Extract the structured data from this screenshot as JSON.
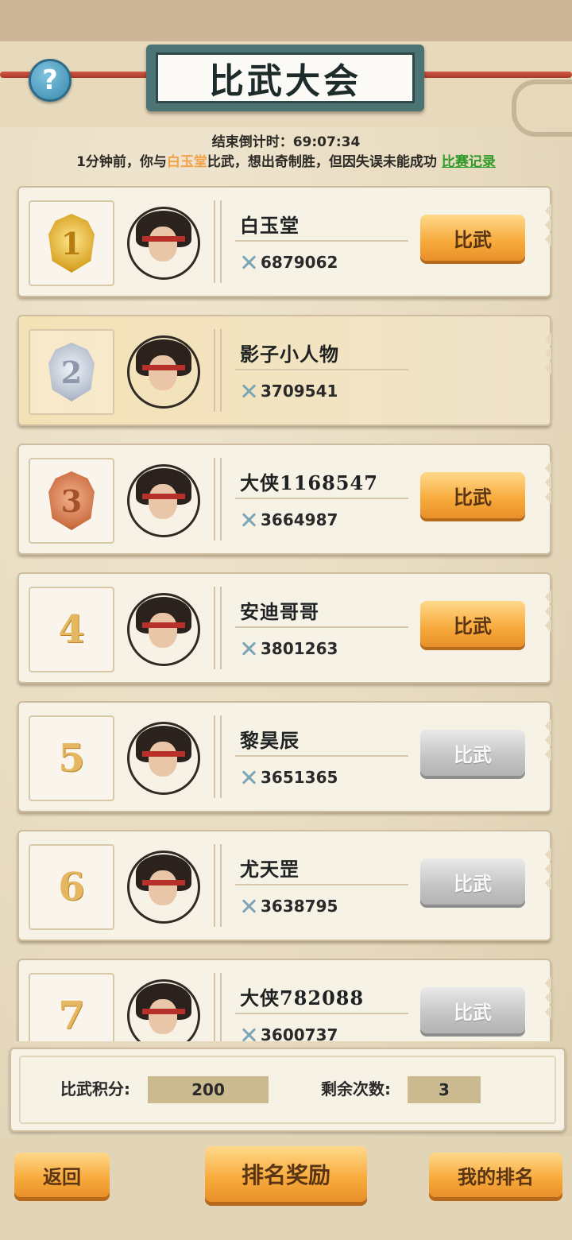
{
  "header": {
    "title": "比武大会",
    "help_icon_glyph": "?"
  },
  "countdown": {
    "label": "结束倒计时：",
    "value": "69:07:34"
  },
  "notice": {
    "prefix": "1分钟前，你与",
    "opponent": "白玉堂",
    "suffix": "比武，想出奇制胜，但因失误未能成功",
    "record_link": "比赛记录"
  },
  "players": [
    {
      "rank": "1",
      "medal": "gold",
      "name": "白玉堂",
      "power": "6879062",
      "button": "比武",
      "enabled": true,
      "is_self": false
    },
    {
      "rank": "2",
      "medal": "silver",
      "name": "影子小人物",
      "power": "3709541",
      "button": "",
      "enabled": false,
      "is_self": true
    },
    {
      "rank": "3",
      "medal": "bronze",
      "name": "大侠1168547",
      "power": "3664987",
      "button": "比武",
      "enabled": true,
      "is_self": false
    },
    {
      "rank": "4",
      "medal": "",
      "name": "安迪哥哥",
      "power": "3801263",
      "button": "比武",
      "enabled": true,
      "is_self": false
    },
    {
      "rank": "5",
      "medal": "",
      "name": "黎昊辰",
      "power": "3651365",
      "button": "比武",
      "enabled": false,
      "is_self": false
    },
    {
      "rank": "6",
      "medal": "",
      "name": "尤天罡",
      "power": "3638795",
      "button": "比武",
      "enabled": false,
      "is_self": false
    },
    {
      "rank": "7",
      "medal": "",
      "name": "大侠782088",
      "power": "3600737",
      "button": "比武",
      "enabled": false,
      "is_self": false
    }
  ],
  "footer": {
    "score_label": "比武积分:",
    "score_value": "200",
    "remaining_label": "剩余次数:",
    "remaining_value": "3"
  },
  "bottom_buttons": {
    "back": "返回",
    "rewards": "排名奖励",
    "my_rank": "我的排名"
  },
  "colors": {
    "accent_orange": "#f7a93a",
    "opponent_highlight": "#f2a24a",
    "record_link": "#2f9a2a",
    "disabled_button": "#c4c4c4"
  }
}
